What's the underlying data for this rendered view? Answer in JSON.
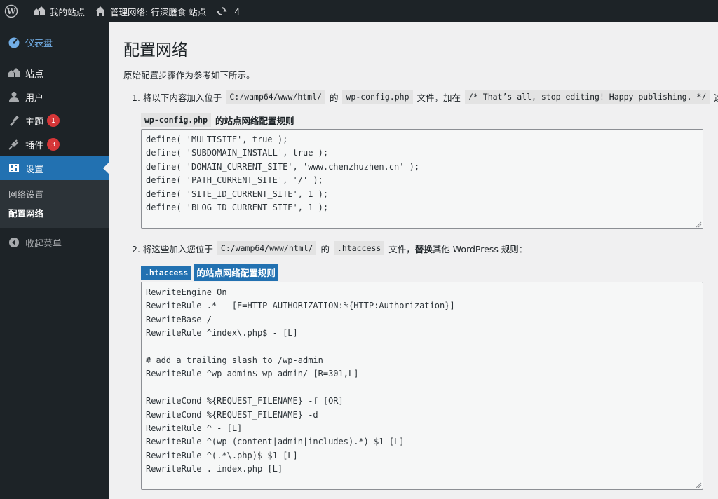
{
  "adminbar": {
    "my_sites": "我的站点",
    "network_admin": "管理网络: 行深膳食 站点",
    "updates_count": "4"
  },
  "sidebar": {
    "items": [
      {
        "label": "仪表盘",
        "icon": "dashboard-icon"
      },
      {
        "label": "站点",
        "icon": "sites-icon"
      },
      {
        "label": "用户",
        "icon": "users-icon"
      },
      {
        "label": "主题",
        "icon": "themes-icon",
        "badge": "1"
      },
      {
        "label": "插件",
        "icon": "plugins-icon",
        "badge": "3"
      },
      {
        "label": "设置",
        "icon": "settings-icon",
        "current": true
      }
    ],
    "submenu": [
      {
        "label": "网络设置"
      },
      {
        "label": "配置网络",
        "active": true
      }
    ],
    "collapse_label": "收起菜单"
  },
  "main": {
    "title": "配置网络",
    "intro": "原始配置步骤作为参考如下所示。",
    "step1": {
      "prefix": "1. 将以下内容加入位于",
      "path": "C:/wamp64/www/html/",
      "of": "的",
      "file": "wp-config.php",
      "mid": "文件，加在",
      "marker": "/* That’s all, stop editing! Happy publishing. */",
      "suffix": "这行"
    },
    "label1": {
      "code": "wp-config.php",
      "text": "的站点网络配置规则"
    },
    "wpconfig_lines": [
      "define( 'MULTISITE', true );",
      "define( 'SUBDOMAIN_INSTALL', true );",
      "define( 'DOMAIN_CURRENT_SITE', 'www.chenzhuzhen.cn' );",
      "define( 'PATH_CURRENT_SITE', '/' );",
      "define( 'SITE_ID_CURRENT_SITE', 1 );",
      "define( 'BLOG_ID_CURRENT_SITE', 1 );"
    ],
    "step2": {
      "prefix": "2. 将这些加入您位于",
      "path": "C:/wamp64/www/html/",
      "of": "的",
      "file": ".htaccess",
      "mid": "文件，",
      "bold": "替换",
      "suffix": "其他 WordPress 规则："
    },
    "label2": {
      "code": ".htaccess",
      "text": "的站点网络配置规则"
    },
    "htaccess_lines": [
      "RewriteEngine On",
      "RewriteRule .* - [E=HTTP_AUTHORIZATION:%{HTTP:Authorization}]",
      "RewriteBase /",
      "RewriteRule ^index\\.php$ - [L]",
      "",
      "# add a trailing slash to /wp-admin",
      "RewriteRule ^wp-admin$ wp-admin/ [R=301,L]",
      "",
      "RewriteCond %{REQUEST_FILENAME} -f [OR]",
      "RewriteCond %{REQUEST_FILENAME} -d",
      "RewriteRule ^ - [L]",
      "RewriteRule ^(wp-(content|admin|includes).*) $1 [L]",
      "RewriteRule ^(.*\\.php)$ $1 [L]",
      "RewriteRule . index.php [L]"
    ]
  },
  "colors": {
    "adminbar_bg": "#1d2327",
    "accent": "#2271b1",
    "badge": "#d63638"
  }
}
